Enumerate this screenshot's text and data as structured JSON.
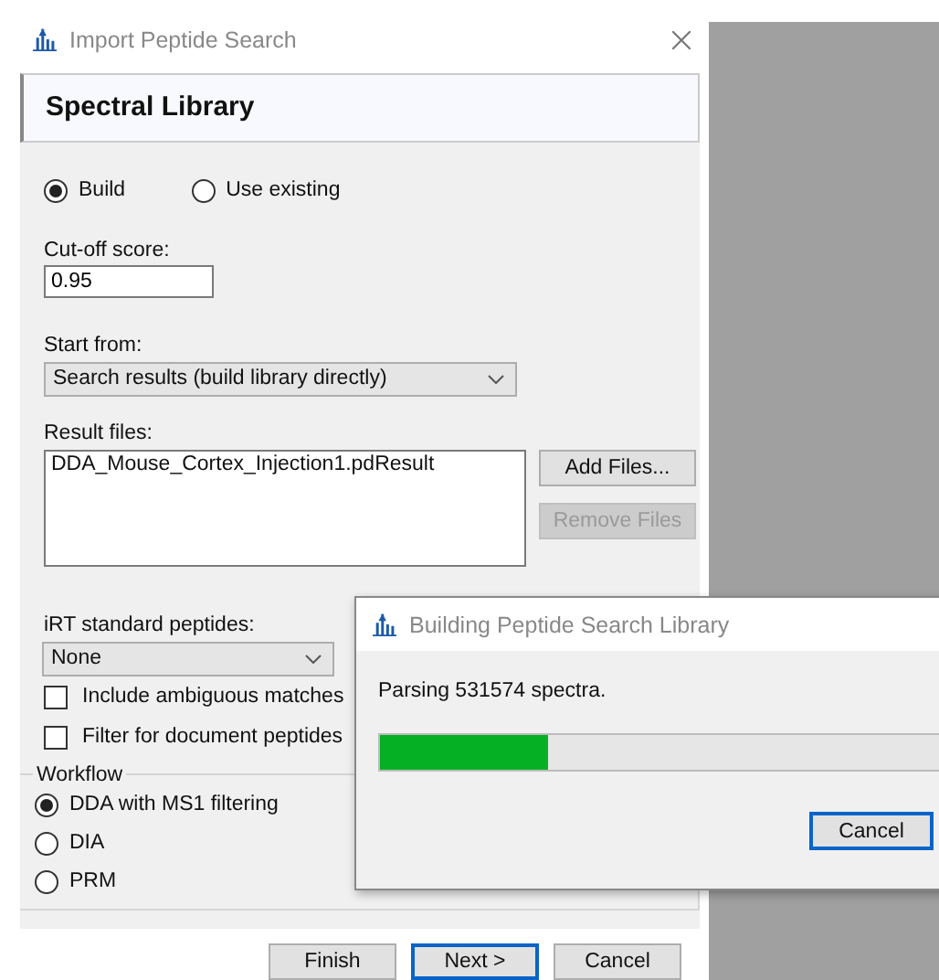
{
  "window": {
    "title": "Import Peptide Search"
  },
  "page": {
    "title": "Spectral Library"
  },
  "library_mode": [
    {
      "label": "Build",
      "selected": true
    },
    {
      "label": "Use existing",
      "selected": false
    }
  ],
  "cutoff": {
    "label": "Cut-off score:",
    "value": "0.95"
  },
  "start_from": {
    "label": "Start from:",
    "value": "Search results (build library directly)"
  },
  "result_files": {
    "label": "Result files:",
    "files": [
      "DDA_Mouse_Cortex_Injection1.pdResult"
    ]
  },
  "file_buttons": [
    {
      "label": "Add Files...",
      "disabled": false
    },
    {
      "label": "Remove Files",
      "disabled": true
    }
  ],
  "irt": {
    "label": "iRT standard peptides:",
    "value": "None"
  },
  "options": [
    {
      "label": "Include ambiguous matches",
      "checked": false
    },
    {
      "label": "Filter for document peptides",
      "checked": false
    }
  ],
  "workflow": {
    "label": "Workflow",
    "options": [
      {
        "label": "DDA with MS1 filtering",
        "selected": true
      },
      {
        "label": "DIA",
        "selected": false
      },
      {
        "label": "PRM",
        "selected": false
      }
    ]
  },
  "buttons": [
    {
      "label": "Finish",
      "default": false
    },
    {
      "label": "Next >",
      "default": true
    },
    {
      "label": "Cancel",
      "default": false
    }
  ],
  "progress_dialog": {
    "title": "Building Peptide Search Library",
    "message": "Parsing 531574 spectra.",
    "level": 0.29,
    "buttons": [
      {
        "label": "Cancel",
        "default": true
      }
    ]
  }
}
